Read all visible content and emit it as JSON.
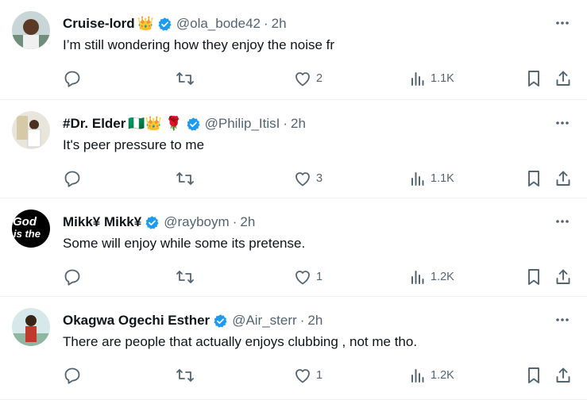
{
  "tweets": [
    {
      "name": "Cruise-lord",
      "emojis": "👑",
      "handle": "@ola_bode42",
      "dot": "·",
      "time": "2h",
      "text": "I’m still wondering how they enjoy the noise fr",
      "likes": "2",
      "views": "1.1K"
    },
    {
      "name": "#Dr. Elder",
      "emojis": "🇳🇬👑 🌹",
      "handle": "@Philip_ItisI",
      "dot": "·",
      "time": "2h",
      "text": "It's peer pressure to me",
      "likes": "3",
      "views": "1.1K"
    },
    {
      "name": "Mikk¥ Mikk¥",
      "emojis": "",
      "handle": "@rayboym",
      "dot": "·",
      "time": "2h",
      "text": "Some will enjoy while some its pretense.",
      "likes": "1",
      "views": "1.2K",
      "avatar_text": [
        "God",
        "is the"
      ]
    },
    {
      "name": "Okagwa Ogechi Esther",
      "emojis": "",
      "handle": "@Air_sterr",
      "dot": "·",
      "time": "2h",
      "text": "There are people that actually enjoys clubbing , not me tho.",
      "likes": "1",
      "views": "1.2K"
    }
  ],
  "colors": {
    "verified": "#1d9bf0",
    "muted": "#536471",
    "text": "#0f1419",
    "divider": "#eff3f4"
  }
}
